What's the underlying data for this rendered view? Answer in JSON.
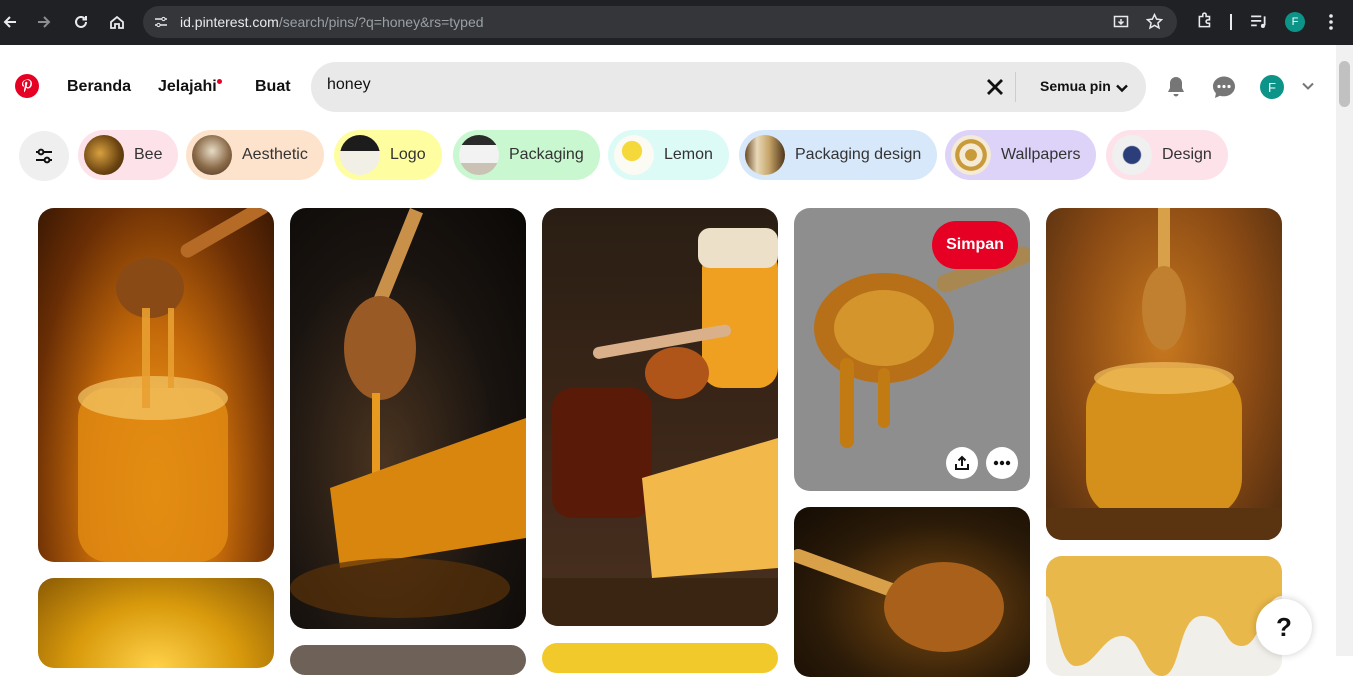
{
  "browser": {
    "url_host": "id.pinterest.com",
    "url_path": "/search/pins/?q=honey&rs=typed",
    "profile_initial": "F"
  },
  "header": {
    "nav": [
      "Beranda",
      "Jelajahi",
      "Buat"
    ],
    "search_value": "honey",
    "scope_label": "Semua pin",
    "avatar_initial": "F"
  },
  "chips": [
    {
      "label": "Bee",
      "bg": "#fde2ea"
    },
    {
      "label": "Aesthetic",
      "bg": "#fde3cc"
    },
    {
      "label": "Logo",
      "bg": "#fefea0"
    },
    {
      "label": "Packaging",
      "bg": "#c9f7d0"
    },
    {
      "label": "Lemon",
      "bg": "#dcfaf6"
    },
    {
      "label": "Packaging design",
      "bg": "#d7e8fb"
    },
    {
      "label": "Wallpapers",
      "bg": "#ddd3f8"
    },
    {
      "label": "Design",
      "bg": "#fde2ea"
    }
  ],
  "hover_pin": {
    "save_label": "Simpan"
  },
  "help_label": "?",
  "colors": {
    "brand": "#e60023",
    "avatar": "#0d9488"
  }
}
